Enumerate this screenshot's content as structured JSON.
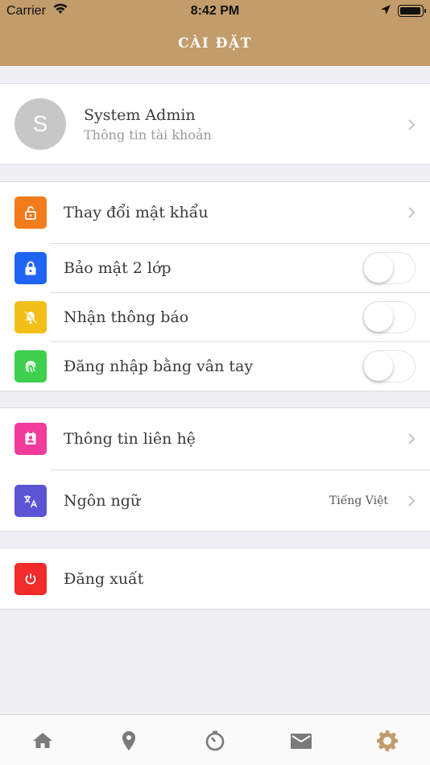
{
  "status_bar": {
    "carrier": "Carrier",
    "time": "8:42 PM"
  },
  "header": {
    "title": "CÀI ĐẶT"
  },
  "profile": {
    "avatar_letter": "S",
    "name": "System Admin",
    "subtitle": "Thông tin tài khoản"
  },
  "security": [
    {
      "label": "Thay đổi mật khẩu",
      "icon": "unlock-icon",
      "color": "#f27b1a",
      "control": "chevron"
    },
    {
      "label": "Bảo mật 2 lớp",
      "icon": "lock-icon",
      "color": "#1f64f2",
      "control": "toggle",
      "on": false
    },
    {
      "label": "Nhận thông báo",
      "icon": "bell-off-icon",
      "color": "#f1bf18",
      "control": "toggle",
      "on": false
    },
    {
      "label": "Đăng nhập bằng vân tay",
      "icon": "fingerprint-icon",
      "color": "#3ecf4c",
      "control": "toggle",
      "on": false
    }
  ],
  "info": [
    {
      "label": "Thông tin liên hệ",
      "icon": "contact-icon",
      "color": "#f23b9c",
      "control": "chevron"
    },
    {
      "label": "Ngôn ngữ",
      "icon": "translate-icon",
      "color": "#5b55d6",
      "control": "chevron",
      "value": "Tiếng Việt"
    }
  ],
  "logout": {
    "label": "Đăng xuất",
    "icon": "power-icon",
    "color": "#f22b2b"
  },
  "tabbar": {
    "items": [
      {
        "name": "home-icon",
        "active": false
      },
      {
        "name": "location-pin-icon",
        "active": false
      },
      {
        "name": "timer-icon",
        "active": false
      },
      {
        "name": "mail-icon",
        "active": false
      },
      {
        "name": "settings-gear-icon",
        "active": true
      }
    ],
    "active_color": "#c29c6a",
    "inactive_color": "#7a7a7a"
  }
}
